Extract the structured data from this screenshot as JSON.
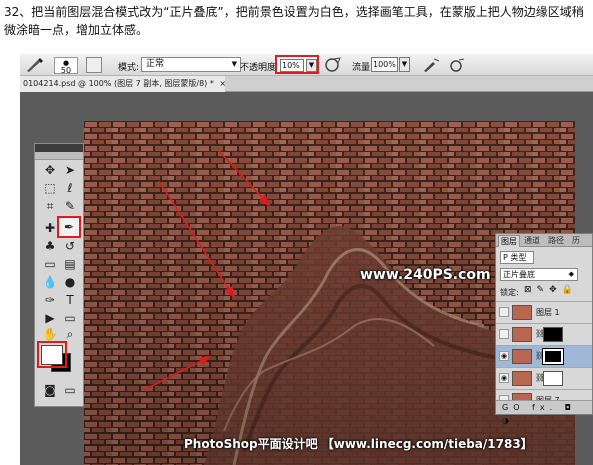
{
  "instruction": "32、把当前图层混合模式改为“正片叠底”，把前景色设置为白色，选择画笔工具，在蒙版上把人物边缘区域稍微涂暗一点，增加立体感。",
  "options_bar": {
    "brush_size": "50",
    "mode_label": "模式:",
    "mode_value": "正常",
    "opacity_label": "不透明度:",
    "opacity_value": "10%",
    "flow_label": "流量:",
    "flow_value": "100%"
  },
  "document_tab": {
    "title": "0104214.psd @ 100% (图层 7 副本, 图层蒙版/8) *",
    "close": "×"
  },
  "canvas": {
    "watermark": "www.240PS.com",
    "credit": "PhotoShop平面设计吧 【www.linecg.com/tieba/1783】"
  },
  "toolbox": {
    "foreground_color": "#ffffff",
    "background_color": "#000000"
  },
  "layers_panel": {
    "tabs": [
      "图层",
      "通道",
      "路径",
      "历"
    ],
    "filter_value": "P 类型",
    "blend_mode": "正片叠底",
    "lock_label": "锁定:",
    "rows": [
      {
        "name": "图层 1"
      },
      {
        "name": ""
      },
      {
        "name": ""
      },
      {
        "name": "图层 7"
      }
    ],
    "footer_icons": "GO fx. ◘ ◑"
  },
  "accent_color": "#e01b1b"
}
